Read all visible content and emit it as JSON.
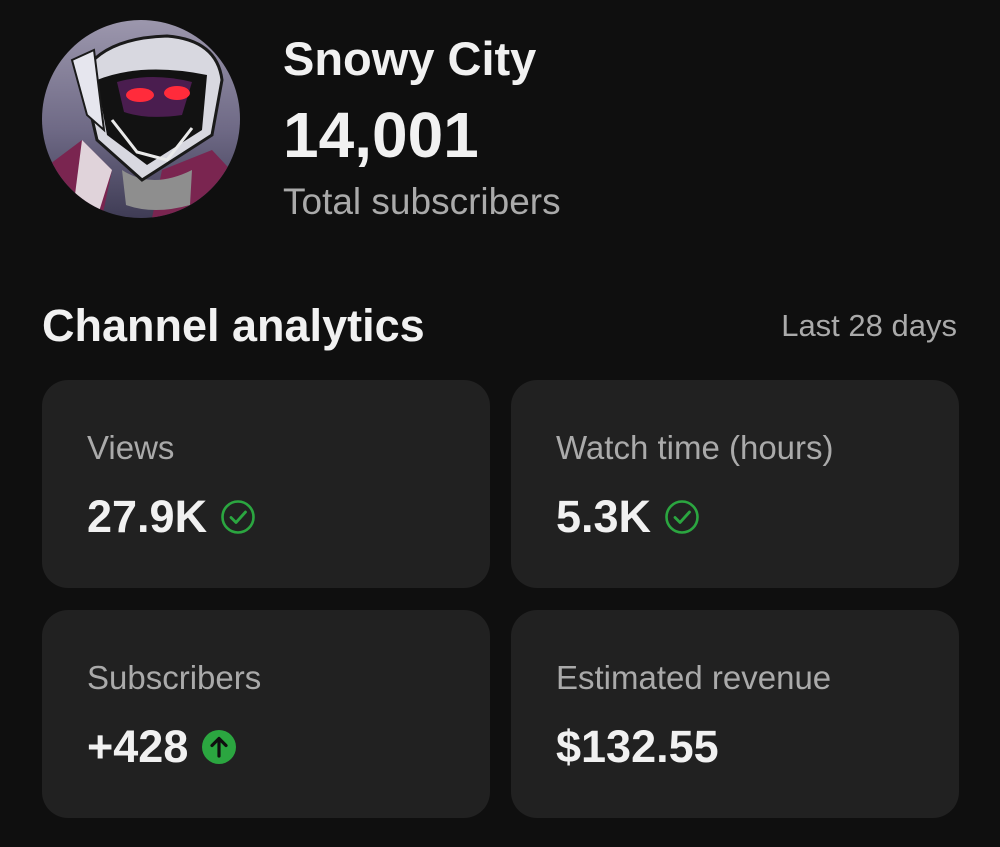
{
  "channel": {
    "name": "Snowy City",
    "subscriber_count": "14,001",
    "subscriber_caption": "Total subscribers",
    "avatar_icon": "channel-avatar-robot"
  },
  "analytics": {
    "title": "Channel analytics",
    "range": "Last 28 days",
    "cards": [
      {
        "label": "Views",
        "value": "27.9K",
        "indicator": "check-circle-icon",
        "indicator_color": "#2ba640"
      },
      {
        "label": "Watch time (hours)",
        "value": "5.3K",
        "indicator": "check-circle-icon",
        "indicator_color": "#2ba640"
      },
      {
        "label": "Subscribers",
        "value": "+428",
        "indicator": "arrow-up-circle-icon",
        "indicator_color": "#2ba640"
      },
      {
        "label": "Estimated revenue",
        "value": "$132.55",
        "indicator": null
      }
    ]
  },
  "colors": {
    "background": "#0f0f0f",
    "card": "#212121",
    "text_primary": "#f1f1f1",
    "text_secondary": "#aaaaaa",
    "positive": "#2ba640"
  }
}
